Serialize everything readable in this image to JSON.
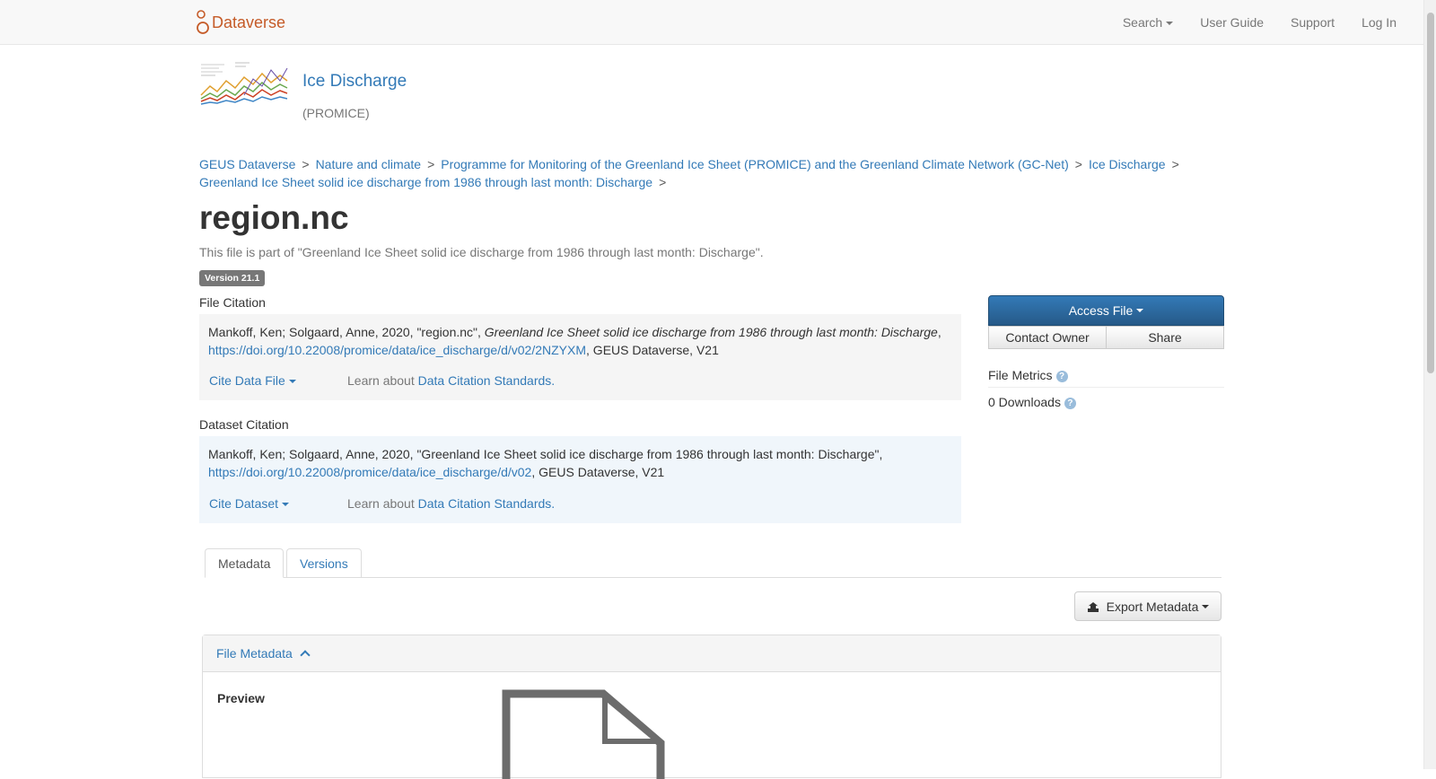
{
  "navbar": {
    "brand": "Dataverse",
    "search": "Search",
    "user_guide": "User Guide",
    "support": "Support",
    "login": "Log In"
  },
  "dataverse": {
    "name": "Ice Discharge",
    "affiliation": "(PROMICE)"
  },
  "breadcrumb": [
    "GEUS Dataverse",
    "Nature and climate",
    "Programme for Monitoring of the Greenland Ice Sheet (PROMICE) and the Greenland Climate Network (GC-Net)",
    "Ice Discharge",
    "Greenland Ice Sheet solid ice discharge from 1986 through last month: Discharge"
  ],
  "file": {
    "title": "region.nc",
    "part_of": "This file is part of \"Greenland Ice Sheet solid ice discharge from 1986 through last month: Discharge\".",
    "version": "Version 21.1"
  },
  "file_citation": {
    "label": "File Citation",
    "authors": "Mankoff, Ken; Solgaard, Anne, 2020, \"region.nc\", ",
    "dataset_title": "Greenland Ice Sheet solid ice discharge from 1986 through last month: Discharge",
    "comma": ",",
    "doi": "https://doi.org/10.22008/promice/data/ice_discharge/d/v02/2NZYXM",
    "suffix": ", GEUS Dataverse, V21",
    "cite_button": "Cite Data File",
    "learn_text": "Learn about ",
    "learn_link": "Data Citation Standards."
  },
  "dataset_citation": {
    "label": "Dataset Citation",
    "text": "Mankoff, Ken; Solgaard, Anne, 2020, \"Greenland Ice Sheet solid ice discharge from 1986 through last month: Discharge\", ",
    "doi": "https://doi.org/10.22008/promice/data/ice_discharge/d/v02",
    "suffix": ", GEUS Dataverse, V21",
    "cite_button": "Cite Dataset",
    "learn_text": "Learn about ",
    "learn_link": "Data Citation Standards."
  },
  "actions": {
    "access_file": "Access File",
    "contact_owner": "Contact Owner",
    "share": "Share"
  },
  "metrics": {
    "title": "File Metrics",
    "downloads": "0 Downloads"
  },
  "tabs": {
    "metadata": "Metadata",
    "versions": "Versions"
  },
  "export_metadata": "Export Metadata",
  "file_metadata": {
    "heading": "File Metadata",
    "preview_label": "Preview"
  }
}
